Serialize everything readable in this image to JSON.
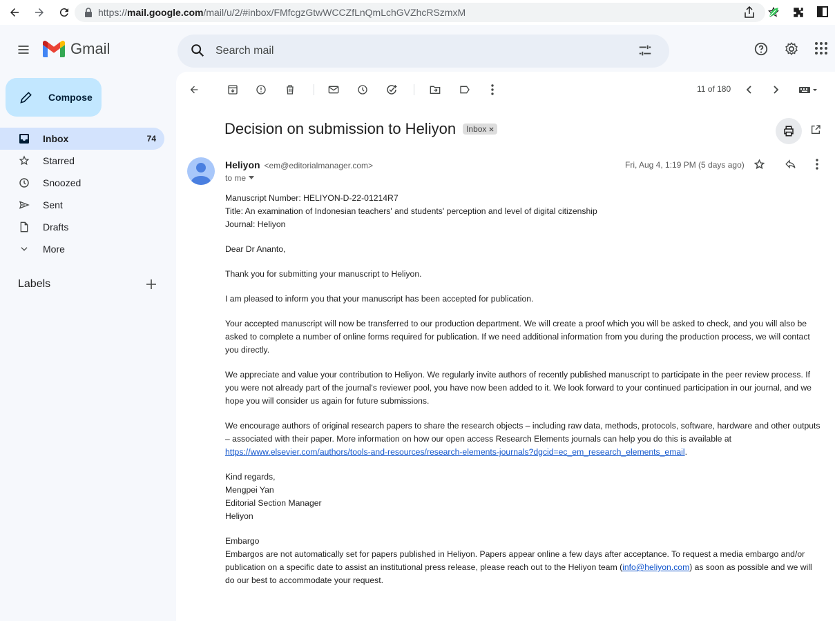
{
  "browser": {
    "url_scheme": "https://",
    "url_host": "mail.google.com",
    "url_path": "/mail/u/2/#inbox/FMfcgzGtwWCCZfLnQmLchGVZhcRSzmxM"
  },
  "header": {
    "app_name": "Gmail",
    "search_placeholder": "Search mail"
  },
  "sidebar": {
    "compose_label": "Compose",
    "items": [
      {
        "label": "Inbox",
        "count": "74",
        "icon": "inbox-icon"
      },
      {
        "label": "Starred",
        "count": "",
        "icon": "star-icon"
      },
      {
        "label": "Snoozed",
        "count": "",
        "icon": "clock-icon"
      },
      {
        "label": "Sent",
        "count": "",
        "icon": "send-icon"
      },
      {
        "label": "Drafts",
        "count": "",
        "icon": "draft-icon"
      },
      {
        "label": "More",
        "count": "",
        "icon": "chevron-down-icon"
      }
    ],
    "labels_title": "Labels"
  },
  "toolbar": {
    "pager": "11 of 180"
  },
  "message": {
    "subject": "Decision on submission to Heliyon",
    "label_chip": "Inbox",
    "sender_name": "Heliyon",
    "sender_email": "<em@editorialmanager.com>",
    "to": "to me",
    "date": "Fri, Aug 4, 1:19 PM (5 days ago)",
    "body": {
      "header_lines": [
        "Manuscript Number: HELIYON-D-22-01214R7",
        "Title: An examination of Indonesian teachers' and students' perception and level of digital citizenship",
        "Journal: Heliyon"
      ],
      "greeting": "Dear Dr Ananto,",
      "p1": "Thank you for submitting your manuscript to Heliyon.",
      "p2": "I am pleased to inform you that your manuscript has been accepted for publication.",
      "p3": "Your accepted manuscript will now be transferred to our production department. We will create a proof which you will be asked to check, and you will also be asked to complete a number of online forms required for publication. If we need additional information from you during the production process, we will contact you directly.",
      "p4": "We appreciate and value your contribution to Heliyon. We regularly invite authors of recently published manuscript to participate in the peer review process. If you were not already part of the journal's reviewer pool, you have now been added to it. We look forward to your continued participation in our journal, and we hope you will consider us again for future submissions.",
      "p5_text": "We encourage authors of original research papers to share the research objects – including raw data, methods, protocols, software, hardware and other outputs – associated with their paper. More information on how our open access Research Elements journals can help you do this is available at ",
      "p5_link": "https://www.elsevier.com/authors/tools-and-resources/research-elements-journals?dgcid=ec_em_research_elements_email",
      "p5_end": ".",
      "signoff_lines": [
        "Kind regards,",
        "Mengpei Yan",
        "Editorial Section Manager",
        "Heliyon"
      ],
      "embargo_title": "Embargo",
      "embargo_text": "Embargos are not automatically set for papers published in Heliyon. Papers appear online a few days after acceptance. To request a media embargo and/or publication on a specific date to assist an institutional press release, please reach out to the Heliyon team (",
      "embargo_link": "info@heliyon.com",
      "embargo_end": ") as soon as possible and we will do our best to accommodate your request."
    }
  },
  "colors": {
    "compose_bg": "#c2e7ff",
    "active_nav_bg": "#d3e3fd",
    "search_bg": "#e9eef6",
    "link": "#1155cc"
  }
}
